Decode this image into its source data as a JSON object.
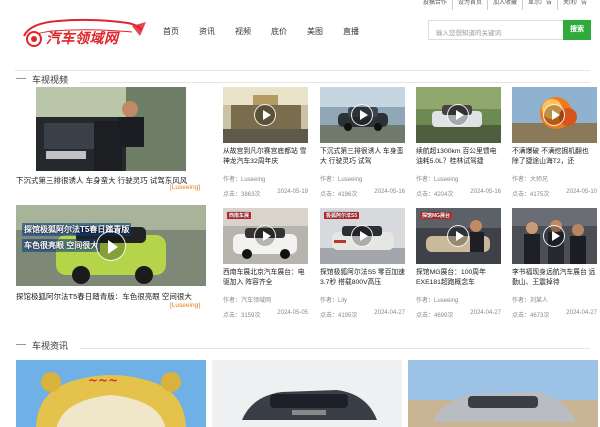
{
  "topbar": {
    "links": [
      "投稿合作",
      "设为首页",
      "加入收藏",
      "显示广告",
      "关闭广告"
    ]
  },
  "logo": {
    "text": "汽车领域网",
    "color": "#e0262b"
  },
  "nav": {
    "items": [
      "首页",
      "资讯",
      "视频",
      "底价",
      "美图",
      "直播"
    ]
  },
  "search": {
    "placeholder": "输入您想知道的关键词",
    "button": "搜索",
    "button_color": "#2eab3b"
  },
  "sections": {
    "video": "车视视频",
    "news": "车视资讯"
  },
  "featured": [
    {
      "title": "下沉式第三排很诱人 车身蛮大 行驶灵巧 试驾东风风",
      "source": "[Luseeing]"
    },
    {
      "title": "探馆极狐阿尔法T5春日踏青版：车色很亮眼 空间很大",
      "source": "[Luseeing]"
    }
  ],
  "cards": [
    {
      "title": "从故宫到凡尔赛宫底都站 雪神龙汽车32周年庆",
      "author": "作者：Luseeing",
      "views": "点击：3863次",
      "date": "2024-05-19"
    },
    {
      "title": "下沉式第三排很诱人 车身蛮大 行驶灵巧 试驾",
      "author": "作者：Luseeing",
      "views": "点击：4196次",
      "date": "2024-05-16"
    },
    {
      "title": "续航超1300km 百公里馈电油耗5.0L？桂林试驾捷",
      "author": "作者：Luseeing",
      "views": "点击：4204次",
      "date": "2024-05-16"
    },
    {
      "title": "不满爆破 不满挖掘机翻也 除了捷途山海T2，还",
      "author": "作者：大师兄",
      "views": "点击：4175次",
      "date": "2024-05-10"
    },
    {
      "title": "西南车展北京汽车展台：电驱加入 阵容齐全",
      "author": "作者：汽车领域网",
      "views": "点击：3159次",
      "date": "2024-05-05"
    },
    {
      "title": "探馆极狐阿尔法S5 零百加速3.7秒 搭载800V高压",
      "author": "作者：Lily",
      "views": "点击：4195次",
      "date": "2024-04-27"
    },
    {
      "title": "探馆MG展台：100周年EXE181超跑概念车",
      "author": "作者：Luseeing",
      "views": "点击：4699次",
      "date": "2024-04-27"
    },
    {
      "title": "李书福现身远航汽车展台 远勤山、王震掉待",
      "author": "作者：刘某人",
      "views": "点击：4673次",
      "date": "2024-04-27"
    }
  ],
  "overlays": {
    "feat2": [
      "探馆极狐阿尔法T5春日踏青版",
      "车色很亮眼 空间很大"
    ],
    "card5": "西南车展",
    "card6": "极狐阿尔法S5",
    "card7": "探馆MG展台"
  }
}
